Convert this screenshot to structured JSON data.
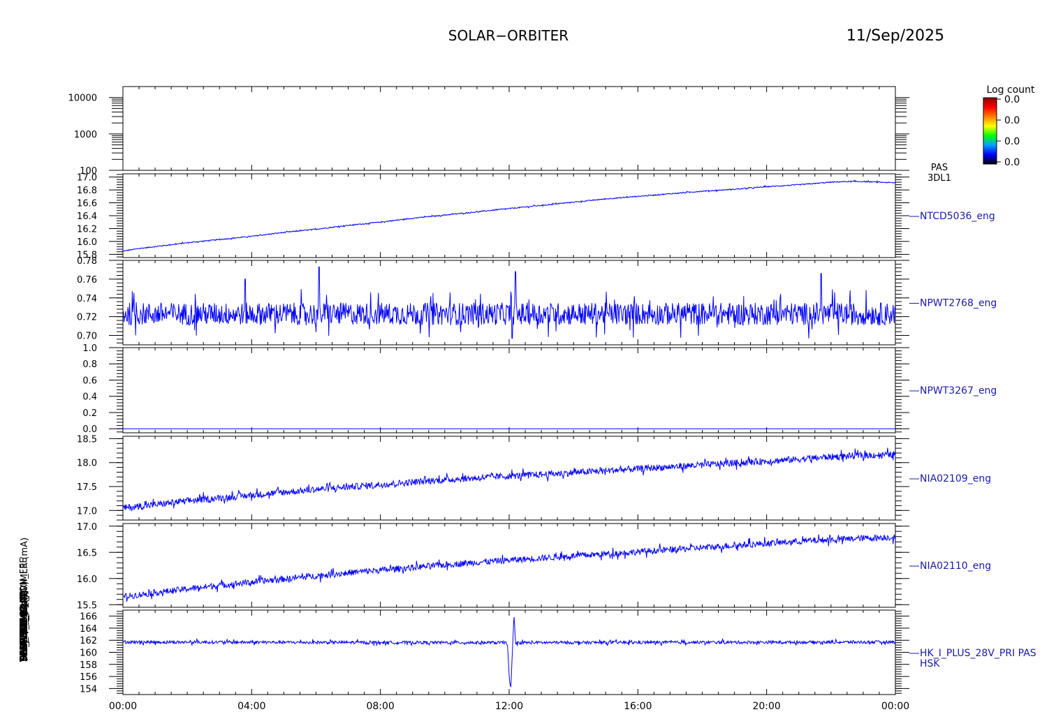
{
  "header": {
    "mission": "SOLAR−ORBITER",
    "date": "11/Sep/2025"
  },
  "colors": {
    "trace": "#0000ff",
    "frame": "#000000",
    "side_label": "#1a1aa8",
    "text": "#000000"
  },
  "colorbar": {
    "title": "Log count",
    "tick_labels": [
      "0.0",
      "0.0",
      "0.0",
      "0.0"
    ],
    "stops": [
      "#000000",
      "#0000ff",
      "#00a0ff",
      "#00ff00",
      "#ffff00",
      "#ff8000",
      "#ff0000",
      "#8b0000"
    ]
  },
  "x_axis": {
    "tick_labels": [
      "00:00",
      "04:00",
      "08:00",
      "12:00",
      "16:00",
      "20:00",
      "00:00"
    ]
  },
  "chart_data": [
    {
      "type": "heatmap",
      "id": "pas-3dl1",
      "side_labels": [
        "PAS",
        "3DL1"
      ],
      "ylabel": "(eV)",
      "yscale": "log",
      "ylim": [
        100,
        20000
      ],
      "yticks": [
        100,
        1000,
        10000
      ],
      "ytick_labels": [
        "100",
        "1000",
        "10000"
      ],
      "values": []
    },
    {
      "type": "line",
      "id": "ntcd5036",
      "side_labels": [
        "NTCD5036_eng"
      ],
      "ylabel": "Temp (DegC)",
      "ylim": [
        15.75,
        17.05
      ],
      "yticks": [
        15.8,
        16.0,
        16.2,
        16.4,
        16.6,
        16.8,
        17.0
      ],
      "ytick_labels": [
        "15.8",
        "16.0",
        "16.2",
        "16.4",
        "16.6",
        "16.8",
        "17.0"
      ],
      "noise": 0.008,
      "series": [
        {
          "x": [
            0,
            0.5,
            1,
            2,
            3,
            4,
            5,
            6,
            7,
            8,
            9,
            10,
            11,
            12,
            13,
            14,
            15,
            16,
            17,
            18,
            19,
            20,
            21,
            22,
            22.5,
            23,
            23.5,
            24
          ],
          "y": [
            15.85,
            15.89,
            15.92,
            15.98,
            16.03,
            16.08,
            16.14,
            16.19,
            16.25,
            16.3,
            16.36,
            16.41,
            16.46,
            16.51,
            16.56,
            16.61,
            16.66,
            16.7,
            16.74,
            16.78,
            16.81,
            16.85,
            16.88,
            16.92,
            16.93,
            16.93,
            16.92,
            16.91
          ]
        }
      ]
    },
    {
      "type": "line",
      "id": "npwt2768",
      "side_labels": [
        "NPWT2768_eng"
      ],
      "ylabel": "",
      "ylim": [
        0.69,
        0.78
      ],
      "yticks": [
        0.7,
        0.72,
        0.74,
        0.76,
        0.78
      ],
      "ytick_labels": [
        "0.70",
        "0.72",
        "0.74",
        "0.76",
        "0.78"
      ],
      "noise": 0.012,
      "spikes": [
        {
          "x": 6.1,
          "y": 0.773
        },
        {
          "x": 12.2,
          "y": 0.768
        },
        {
          "x": 12.1,
          "y": 0.697
        },
        {
          "x": 21.7,
          "y": 0.766
        },
        {
          "x": 3.8,
          "y": 0.76
        }
      ],
      "series": [
        {
          "x": [
            0,
            24
          ],
          "y": [
            0.723,
            0.723
          ]
        }
      ]
    },
    {
      "type": "line",
      "id": "npwt3267",
      "side_labels": [
        "NPWT3267_eng"
      ],
      "ylabel": "",
      "ylim": [
        -0.05,
        1.0
      ],
      "yticks": [
        0.0,
        0.2,
        0.4,
        0.6,
        0.8,
        1.0
      ],
      "ytick_labels": [
        "0.0",
        "0.2",
        "0.4",
        "0.6",
        "0.8",
        "1.0"
      ],
      "noise": 0,
      "series": [
        {
          "x": [
            0,
            24
          ],
          "y": [
            0.0,
            0.0
          ]
        }
      ]
    },
    {
      "type": "line",
      "id": "nia02109",
      "side_labels": [
        "NIA02109_eng"
      ],
      "ylabel": "",
      "ylim": [
        16.8,
        18.55
      ],
      "yticks": [
        17.0,
        17.5,
        18.0,
        18.5
      ],
      "ytick_labels": [
        "17.0",
        "17.5",
        "18.0",
        "18.5"
      ],
      "noise": 0.07,
      "series": [
        {
          "x": [
            0,
            1,
            2,
            3,
            4,
            5,
            6,
            7,
            8,
            9,
            10,
            11,
            12,
            13,
            14,
            15,
            16,
            17,
            18,
            19,
            20,
            21,
            22,
            23,
            24
          ],
          "y": [
            17.05,
            17.12,
            17.2,
            17.26,
            17.32,
            17.38,
            17.44,
            17.49,
            17.54,
            17.59,
            17.64,
            17.68,
            17.72,
            17.75,
            17.79,
            17.83,
            17.87,
            17.91,
            17.95,
            17.99,
            18.03,
            18.07,
            18.12,
            18.15,
            18.17
          ]
        }
      ]
    },
    {
      "type": "line",
      "id": "nia02110",
      "side_labels": [
        "NIA02110_eng"
      ],
      "ylabel": "",
      "ylim": [
        15.45,
        17.05
      ],
      "yticks": [
        15.5,
        16.0,
        16.5,
        17.0
      ],
      "ytick_labels": [
        "15.5",
        "16.0",
        "16.5",
        "17.0"
      ],
      "noise": 0.06,
      "series": [
        {
          "x": [
            0,
            1,
            2,
            3,
            4,
            5,
            6,
            7,
            8,
            9,
            10,
            11,
            12,
            13,
            14,
            15,
            16,
            17,
            18,
            19,
            20,
            21,
            22,
            23,
            24
          ],
          "y": [
            15.65,
            15.73,
            15.8,
            15.87,
            15.93,
            15.99,
            16.05,
            16.11,
            16.16,
            16.21,
            16.26,
            16.31,
            16.35,
            16.39,
            16.43,
            16.47,
            16.51,
            16.55,
            16.59,
            16.63,
            16.67,
            16.71,
            16.74,
            16.77,
            16.79
          ]
        }
      ]
    },
    {
      "type": "line",
      "id": "hk-i-plus-28v",
      "side_labels": [
        "HK_I_PLUS_28V_PRI PAS",
        "HSK"
      ],
      "ylabel": "(mA)",
      "ylim": [
        153,
        167
      ],
      "yticks": [
        154,
        156,
        158,
        160,
        162,
        164,
        166
      ],
      "ytick_labels": [
        "154",
        "156",
        "158",
        "160",
        "162",
        "164",
        "166"
      ],
      "noise": 0.25,
      "series": [
        {
          "x": [
            0,
            11.9,
            11.95,
            12.0,
            12.05,
            12.1,
            12.15,
            12.2,
            12.25,
            24
          ],
          "y": [
            161.7,
            161.6,
            161.4,
            156.0,
            153.6,
            160.0,
            166.1,
            161.2,
            161.6,
            161.7
          ]
        }
      ]
    }
  ],
  "left_axis_labels": [
    "(mA)DM_HK_IMON_FEE",
    "DM_HK_IMON_PRIMLR (mA)",
    "TEMP (Volt)",
    "THERMAL (Volt)",
    "SCM_PCM4 (nT)",
    "SWA-EAS_1 (A)",
    "SWA-EAS_2 (A)",
    "TEDWT2768 (A)",
    "TEDWT3267 (A)",
    "Temp (DegC) (eV)"
  ]
}
